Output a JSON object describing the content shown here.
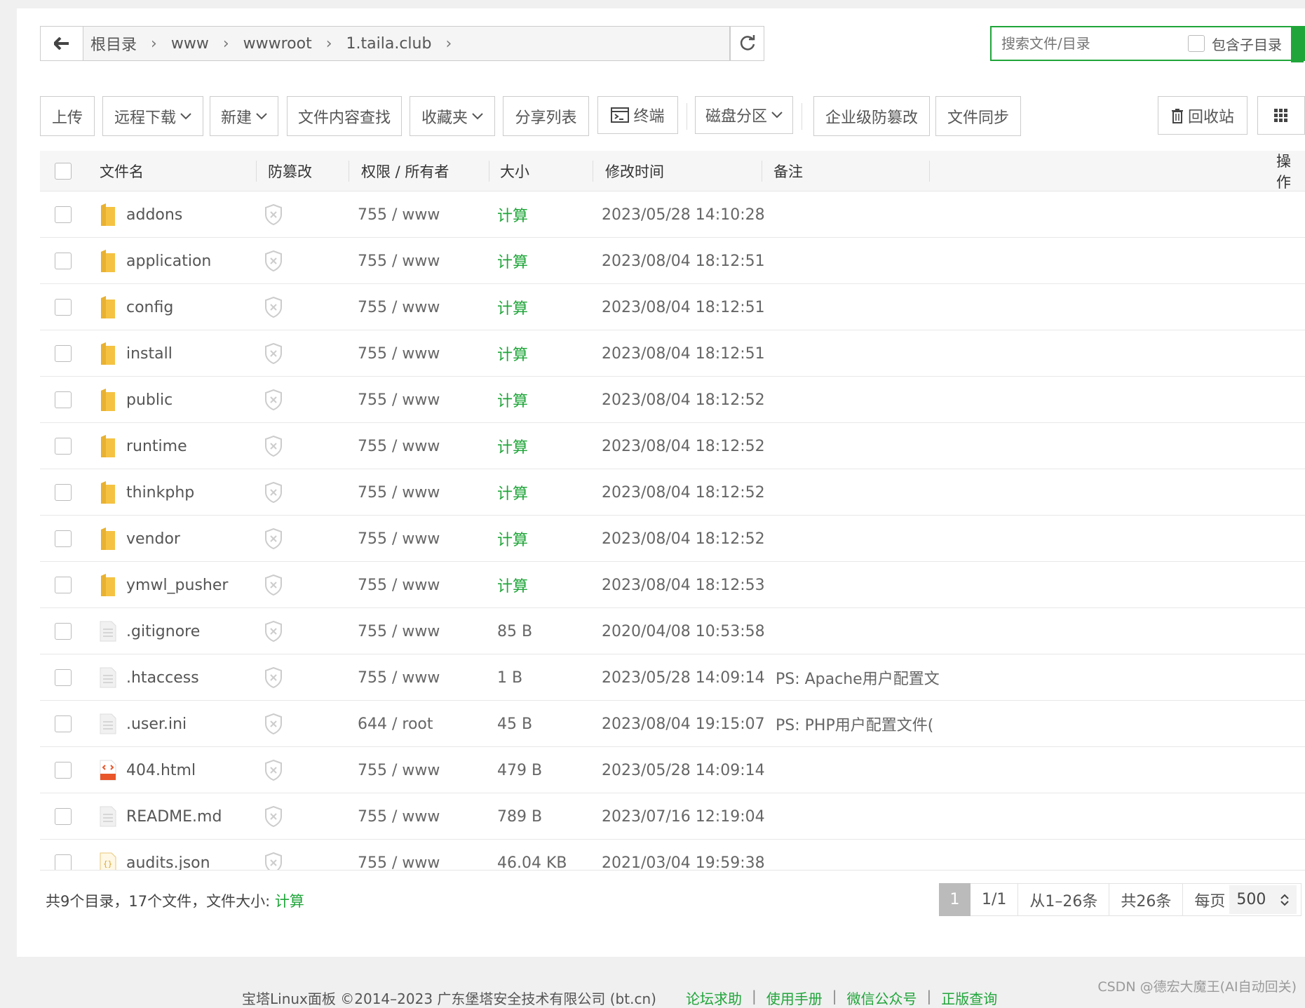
{
  "breadcrumb": {
    "items": [
      "根目录",
      "www",
      "wwwroot",
      "1.taila.club"
    ]
  },
  "search": {
    "placeholder": "搜索文件/目录",
    "include_sub_label": "包含子目录"
  },
  "toolbar": {
    "upload": "上传",
    "remote_download": "远程下载",
    "new": "新建",
    "content_search": "文件内容查找",
    "favorites": "收藏夹",
    "share_list": "分享列表",
    "terminal": "终端",
    "disk_partition": "磁盘分区",
    "enterprise_tamper": "企业级防篡改",
    "file_sync": "文件同步",
    "recycle_bin": "回收站"
  },
  "table": {
    "headers": {
      "name": "文件名",
      "tamper": "防篡改",
      "perm": "权限 / 所有者",
      "size": "大小",
      "mtime": "修改时间",
      "remark": "备注",
      "action": "操作"
    },
    "rows": [
      {
        "name": "addons",
        "type": "folder",
        "perm": "755 / www",
        "size": "计算",
        "mtime": "2023/05/28 14:10:28",
        "remark": ""
      },
      {
        "name": "application",
        "type": "folder",
        "perm": "755 / www",
        "size": "计算",
        "mtime": "2023/08/04 18:12:51",
        "remark": ""
      },
      {
        "name": "config",
        "type": "folder",
        "perm": "755 / www",
        "size": "计算",
        "mtime": "2023/08/04 18:12:51",
        "remark": ""
      },
      {
        "name": "install",
        "type": "folder",
        "perm": "755 / www",
        "size": "计算",
        "mtime": "2023/08/04 18:12:51",
        "remark": ""
      },
      {
        "name": "public",
        "type": "folder",
        "perm": "755 / www",
        "size": "计算",
        "mtime": "2023/08/04 18:12:52",
        "remark": ""
      },
      {
        "name": "runtime",
        "type": "folder",
        "perm": "755 / www",
        "size": "计算",
        "mtime": "2023/08/04 18:12:52",
        "remark": ""
      },
      {
        "name": "thinkphp",
        "type": "folder",
        "perm": "755 / www",
        "size": "计算",
        "mtime": "2023/08/04 18:12:52",
        "remark": ""
      },
      {
        "name": "vendor",
        "type": "folder",
        "perm": "755 / www",
        "size": "计算",
        "mtime": "2023/08/04 18:12:52",
        "remark": ""
      },
      {
        "name": "ymwl_pusher",
        "type": "folder",
        "perm": "755 / www",
        "size": "计算",
        "mtime": "2023/08/04 18:12:53",
        "remark": ""
      },
      {
        "name": ".gitignore",
        "type": "file",
        "perm": "755 / www",
        "size": "85 B",
        "mtime": "2020/04/08 10:53:58",
        "remark": ""
      },
      {
        "name": ".htaccess",
        "type": "file",
        "perm": "755 / www",
        "size": "1 B",
        "mtime": "2023/05/28 14:09:14",
        "remark": "PS: Apache用户配置文"
      },
      {
        "name": ".user.ini",
        "type": "file",
        "perm": "644 / root",
        "size": "45 B",
        "mtime": "2023/08/04 19:15:07",
        "remark": "PS: PHP用户配置文件("
      },
      {
        "name": "404.html",
        "type": "html",
        "perm": "755 / www",
        "size": "479 B",
        "mtime": "2023/05/28 14:09:14",
        "remark": ""
      },
      {
        "name": "README.md",
        "type": "file",
        "perm": "755 / www",
        "size": "789 B",
        "mtime": "2023/07/16 12:19:04",
        "remark": ""
      },
      {
        "name": "audits.json",
        "type": "json",
        "perm": "755 / www",
        "size": "46.04 KB",
        "mtime": "2021/03/04 19:59:38",
        "remark": ""
      }
    ]
  },
  "summary": {
    "text": "共9个目录，17个文件，文件大小: ",
    "calc": "计算"
  },
  "pager": {
    "current": "1",
    "pages": "1/1",
    "range": "从1–26条",
    "total": "共26条",
    "per_page_label": "每页",
    "per_page_value": "500"
  },
  "site_footer": {
    "copyright": "宝塔Linux面板 ©2014–2023 广东堡塔安全技术有限公司 (bt.cn)",
    "links": [
      "论坛求助",
      "使用手册",
      "微信公众号",
      "正版查询"
    ]
  },
  "watermark": "CSDN @德宏大魔王(AI自动回关)",
  "colors": {
    "accent": "#20a53a",
    "folder": "#f5c242"
  }
}
